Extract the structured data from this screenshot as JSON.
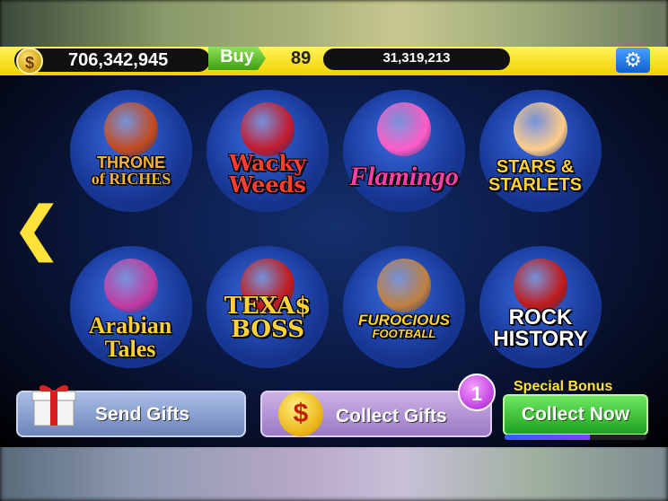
{
  "hud": {
    "coins": "706,342,945",
    "coin_symbol": "$",
    "buy_label": "Buy",
    "level": "89",
    "xp": "31,319,213",
    "settings_icon": "gear-icon"
  },
  "nav": {
    "prev_icon": "chevron-left-icon"
  },
  "games": [
    {
      "line1": "THRONE",
      "line2": "of RICHES",
      "color": "#f3b23a",
      "art": "#c44a1e"
    },
    {
      "line1": "Wacky",
      "line2": "Weeds",
      "color": "#ff3e2e",
      "art": "#c41a2e"
    },
    {
      "line1": "Flamingo",
      "line2": "",
      "color": "#ff3ea6",
      "art": "#ff5cc6"
    },
    {
      "line1": "STARS &",
      "line2": "STARLETS",
      "color": "#ffd23a",
      "art": "#ffcc88"
    },
    {
      "line1": "Arabian",
      "line2": "Tales",
      "color": "#ffcf3a",
      "art": "#c23aa0"
    },
    {
      "line1": "TEXA$",
      "line2": "BOSS",
      "color": "#ffd23a",
      "art": "#c41a1a"
    },
    {
      "line1": "FUROCIOUS",
      "line2": "FOOTBALL",
      "color": "#ffd23a",
      "art": "#c08040"
    },
    {
      "line1": "ROCK",
      "line2": "HISTORY",
      "color": "#ffffff",
      "art": "#c01a1a"
    }
  ],
  "bottom": {
    "send_gifts": "Send Gifts",
    "collect_gifts": "Collect Gifts",
    "gift_count": "1",
    "dollar_symbol": "$",
    "special_bonus": "Special Bonus",
    "collect_now": "Collect Now",
    "bonus_progress": 0.6
  }
}
